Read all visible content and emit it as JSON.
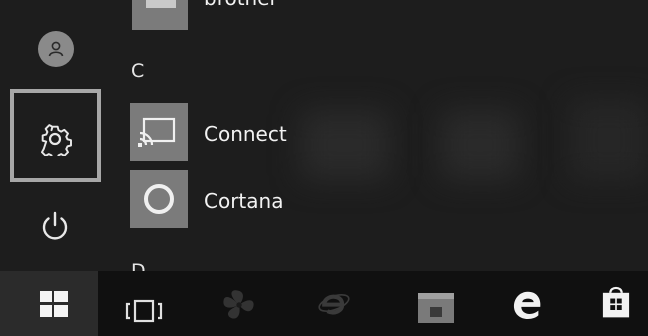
{
  "start_menu": {
    "app_list": [
      {
        "label": "brother",
        "icon": "brother-app-icon"
      },
      {
        "label": "C",
        "type": "section-letter"
      },
      {
        "label": "Connect",
        "icon": "connect-cast-icon"
      },
      {
        "label": "Cortana",
        "icon": "cortana-ring-icon"
      },
      {
        "label": "D",
        "type": "section-letter"
      }
    ],
    "rail": {
      "user_icon": "user-avatar-icon",
      "settings_icon": "gear-icon",
      "power_icon": "power-icon"
    }
  },
  "taskbar": {
    "items": [
      "windows-start-icon",
      "task-view-icon",
      "fan-app-icon",
      "internet-explorer-icon",
      "file-explorer-icon",
      "edge-icon",
      "store-icon"
    ]
  },
  "colors": {
    "highlight_frame": "#a7a7a7",
    "tile": "#7b7b7b",
    "taskbar": "#101010"
  }
}
